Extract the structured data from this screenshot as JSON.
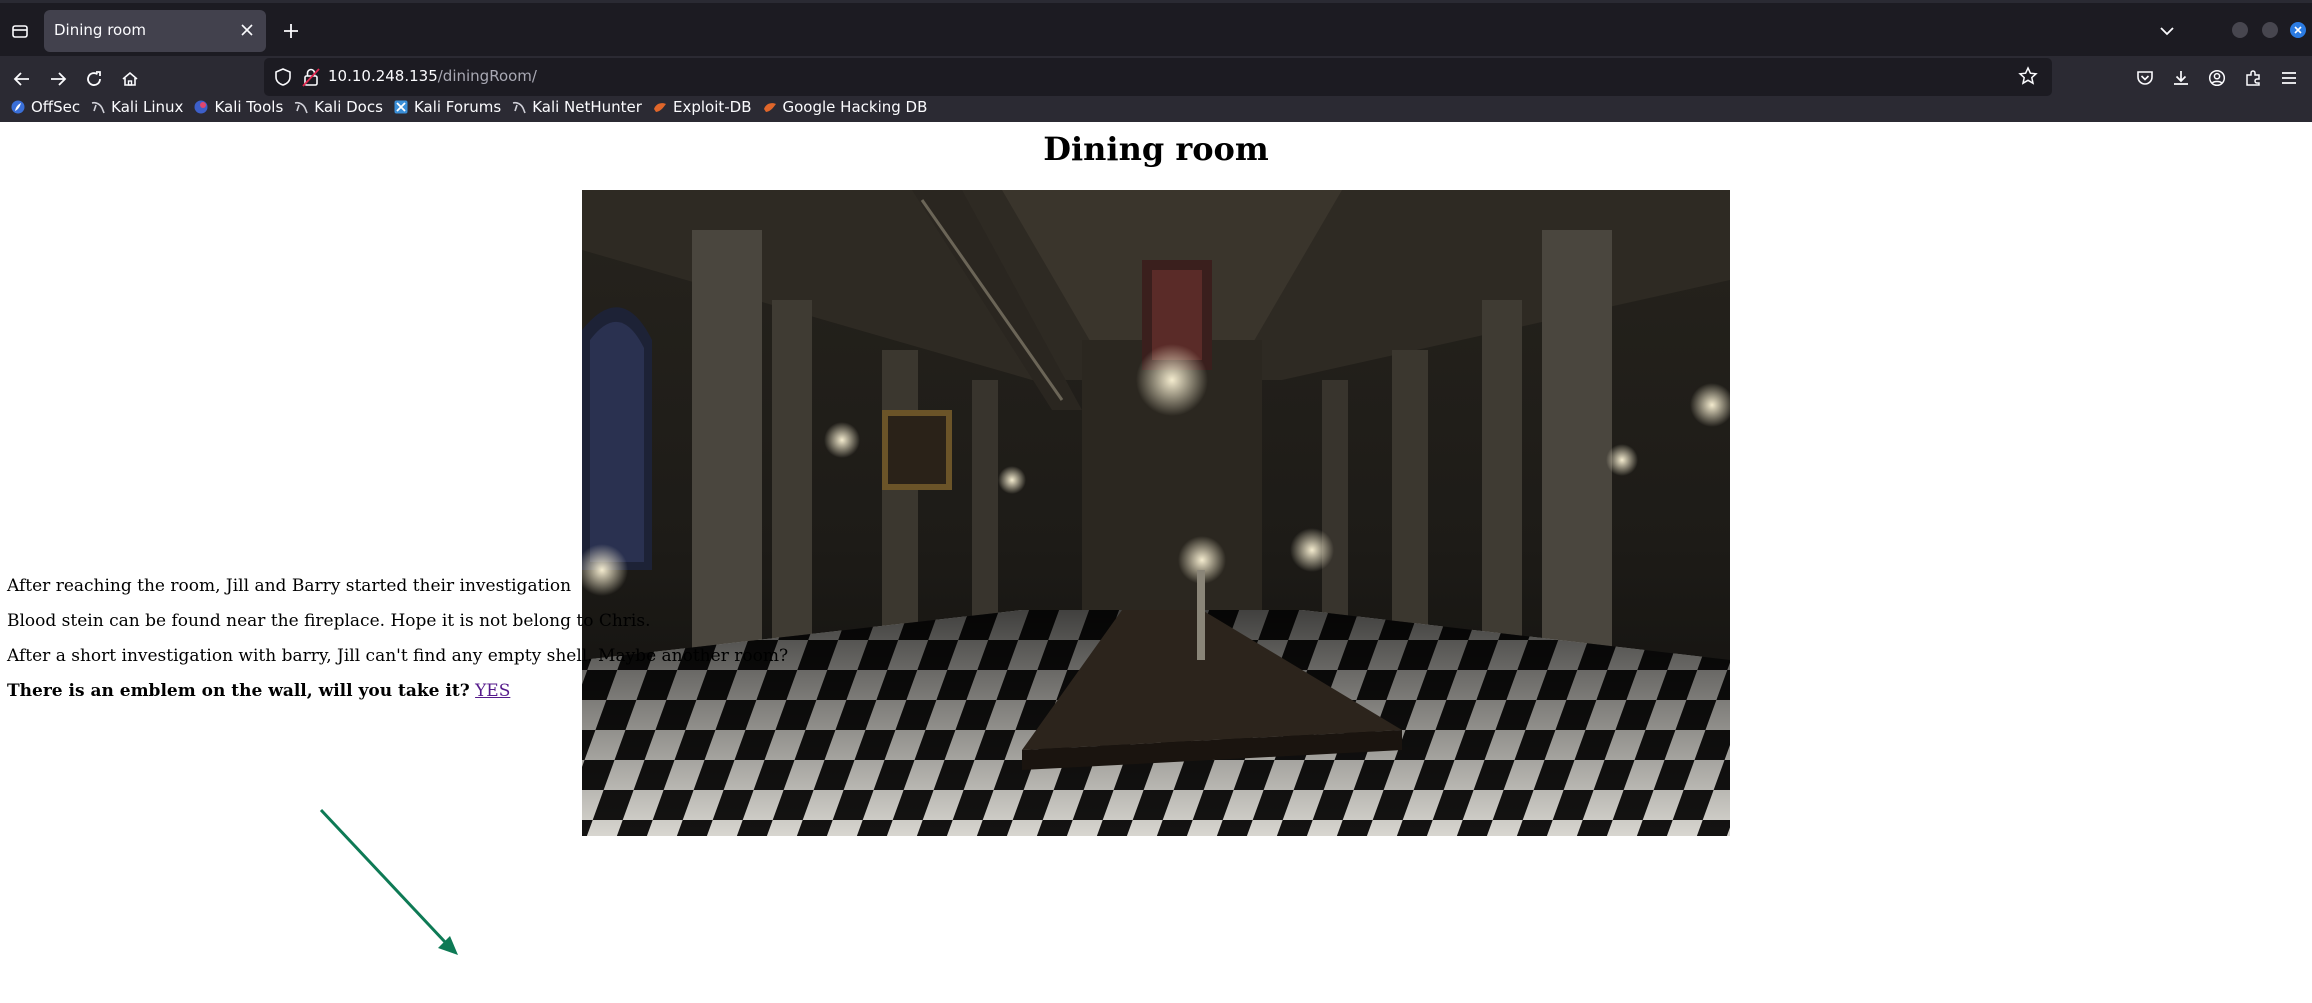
{
  "tab": {
    "title": "Dining room"
  },
  "url": {
    "host": "10.10.248.135",
    "path": "/diningRoom/"
  },
  "bookmarks": [
    {
      "label": "OffSec",
      "icon": "offsec-icon",
      "color": "#3a6fd8"
    },
    {
      "label": "Kali Linux",
      "icon": "kali-dragon-icon",
      "color": "#d0d0d8"
    },
    {
      "label": "Kali Tools",
      "icon": "kali-tools-icon",
      "color": "#e0466e"
    },
    {
      "label": "Kali Docs",
      "icon": "kali-dragon-icon",
      "color": "#d0d0d8"
    },
    {
      "label": "Kali Forums",
      "icon": "kali-forums-icon",
      "color": "#3a8fd8"
    },
    {
      "label": "Kali NetHunter",
      "icon": "kali-dragon-icon",
      "color": "#d0d0d8"
    },
    {
      "label": "Exploit-DB",
      "icon": "exploit-db-icon",
      "color": "#e0662a"
    },
    {
      "label": "Google Hacking DB",
      "icon": "ghdb-icon",
      "color": "#e0662a"
    }
  ],
  "page": {
    "heading": "Dining room",
    "paragraphs": [
      "After reaching the room, Jill and Barry started their investigation",
      "Blood stein can be found near the fireplace. Hope it is not belong to Chris.",
      "After a short investigation with barry, Jill can't find any empty shell. Maybe another room?"
    ],
    "question": "There is an emblem on the wall, will you take it?",
    "link": "YES"
  },
  "colors": {
    "annotation_arrow": "#0e7a55",
    "link_visited": "#551a8b"
  }
}
